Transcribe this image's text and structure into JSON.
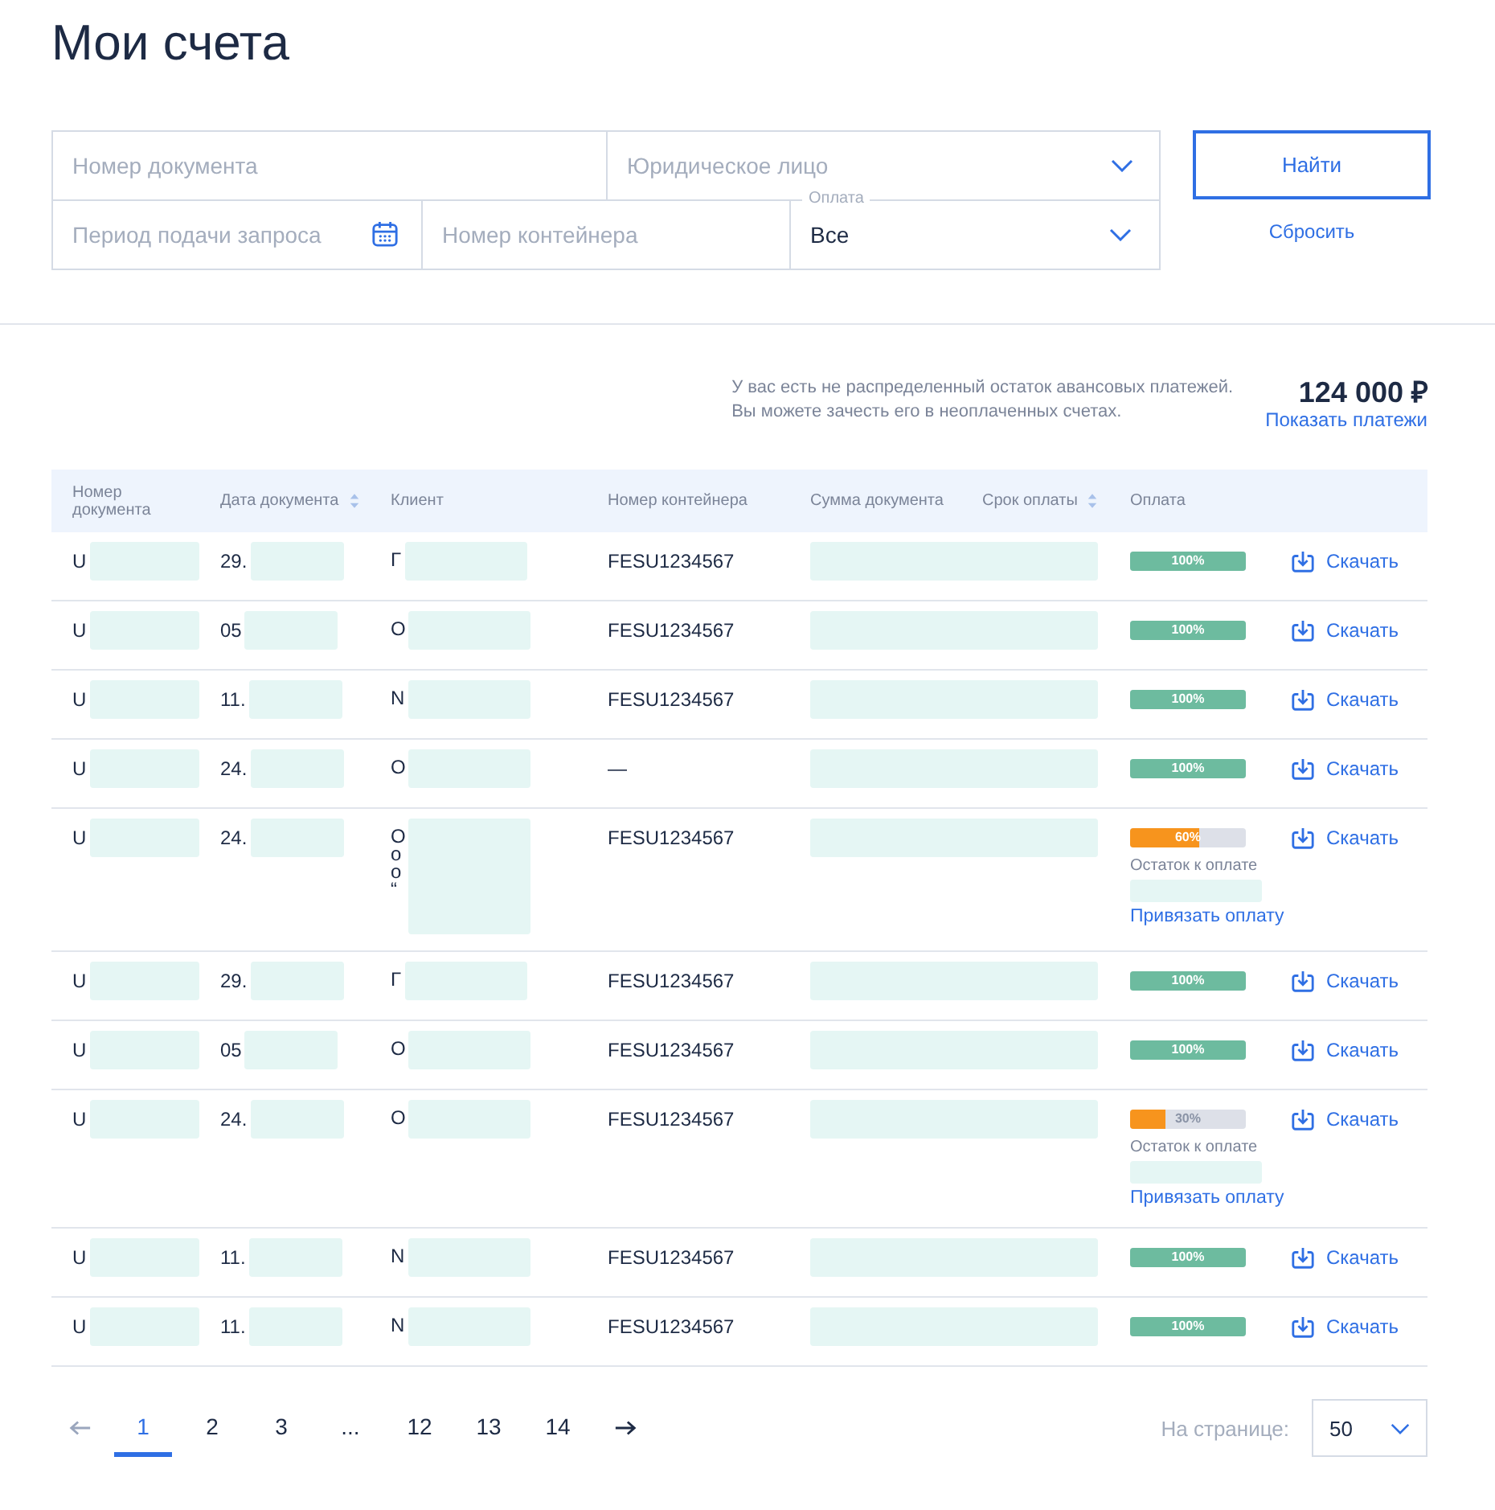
{
  "title": "Мои счета",
  "filters": {
    "document_number": {
      "placeholder": "Номер документа"
    },
    "legal_entity": {
      "placeholder": "Юридическое лицо"
    },
    "period": {
      "placeholder": "Период подачи запроса"
    },
    "container": {
      "placeholder": "Номер контейнера"
    },
    "payment": {
      "label": "Оплата",
      "value": "Все"
    }
  },
  "search_button": "Найти",
  "reset_link": "Сбросить",
  "advance": {
    "message": [
      "У вас есть не распределенный остаток авансовых платежей.",
      "Вы можете зачесть его в неоплаченных счетах."
    ],
    "amount": "124 000 ₽",
    "link": "Показать платежи"
  },
  "table": {
    "columns": [
      {
        "label": "Номер документа",
        "sortable": false
      },
      {
        "label": "Дата документа",
        "sortable": true
      },
      {
        "label": "Клиент",
        "sortable": false
      },
      {
        "label": "Номер контейнера",
        "sortable": false
      },
      {
        "label": "Сумма документа",
        "sortable": false
      },
      {
        "label": "Срок оплаты",
        "sortable": true
      },
      {
        "label": "Оплата",
        "sortable": false
      }
    ],
    "rows": [
      {
        "document": "U",
        "date": "29.",
        "client": [
          "Г"
        ],
        "container": "FESU1234567",
        "payment": {
          "level": 1,
          "label": "100%"
        },
        "download": "Скачать"
      },
      {
        "document": "U",
        "date": "05",
        "client": [
          "О"
        ],
        "container": "FESU1234567",
        "payment": {
          "level": 1,
          "label": "100%"
        },
        "download": "Скачать"
      },
      {
        "document": "U",
        "date": "11.",
        "client": [
          "N"
        ],
        "container": "FESU1234567",
        "payment": {
          "level": 1,
          "label": "100%"
        },
        "download": "Скачать"
      },
      {
        "document": "U",
        "date": "24.",
        "client": [
          "О"
        ],
        "container": "—",
        "payment": {
          "level": 1,
          "label": "100%"
        },
        "download": "Скачать"
      },
      {
        "document": "U",
        "date": "24.",
        "client": [
          "О",
          "о",
          "о",
          "“"
        ],
        "container": "FESU1234567",
        "payment": {
          "level": 0.6,
          "label": "60%",
          "remainder_label": "Остаток к оплате",
          "bind_link": "Привязать оплату"
        },
        "download": "Скачать"
      },
      {
        "document": "U",
        "date": "29.",
        "client": [
          "Г"
        ],
        "container": "FESU1234567",
        "payment": {
          "level": 1,
          "label": "100%"
        },
        "download": "Скачать"
      },
      {
        "document": "U",
        "date": "05",
        "client": [
          "О"
        ],
        "container": "FESU1234567",
        "payment": {
          "level": 1,
          "label": "100%"
        },
        "download": "Скачать"
      },
      {
        "document": "U",
        "date": "24.",
        "client": [
          "О"
        ],
        "container": "FESU1234567",
        "payment": {
          "level": 0.3,
          "label": "30%",
          "remainder_label": "Остаток к оплате",
          "bind_link": "Привязать оплату"
        },
        "download": "Скачать"
      },
      {
        "document": "U",
        "date": "11.",
        "client": [
          "N"
        ],
        "container": "FESU1234567",
        "payment": {
          "level": 1,
          "label": "100%"
        },
        "download": "Скачать"
      },
      {
        "document": "U",
        "date": "11.",
        "client": [
          "N"
        ],
        "container": "FESU1234567",
        "payment": {
          "level": 1,
          "label": "100%"
        },
        "download": "Скачать"
      }
    ]
  },
  "pagination": {
    "pages": [
      {
        "label": "1",
        "selected": true
      },
      {
        "label": "2",
        "selected": false
      },
      {
        "label": "3",
        "selected": false
      },
      {
        "label": "...",
        "selected": false
      },
      {
        "label": "12",
        "selected": false
      },
      {
        "label": "13",
        "selected": false
      },
      {
        "label": "14",
        "selected": false
      }
    ],
    "per_page": {
      "label": "На странице:",
      "value": "50"
    }
  }
}
